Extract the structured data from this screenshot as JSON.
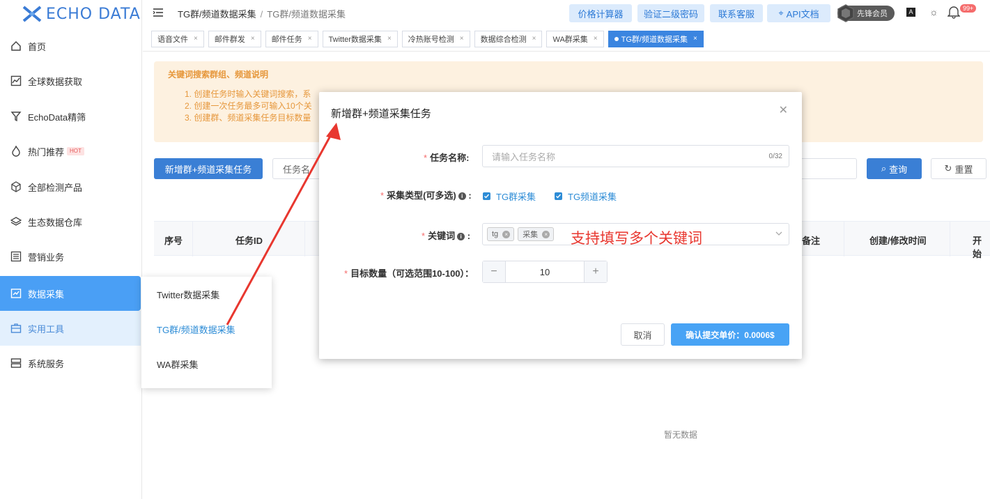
{
  "logo_text": "ECHO DATA",
  "sidebar": {
    "items": [
      {
        "label": "首页",
        "icon": "home-icon"
      },
      {
        "label": "全球数据获取",
        "icon": "chart-line-icon"
      },
      {
        "label": "EchoData精筛",
        "icon": "filter-icon"
      },
      {
        "label": "热门推荐",
        "icon": "fire-icon",
        "badge": "HOT"
      },
      {
        "label": "全部检测产品",
        "icon": "cube-icon"
      },
      {
        "label": "生态数据仓库",
        "icon": "layers-icon"
      },
      {
        "label": "营销业务",
        "icon": "list-icon"
      },
      {
        "label": "数据采集",
        "icon": "collect-icon"
      },
      {
        "label": "实用工具",
        "icon": "briefcase-icon"
      },
      {
        "label": "系统服务",
        "icon": "server-icon"
      }
    ],
    "flyout": [
      "Twitter数据采集",
      "TG群/频道数据采集",
      "WA群采集"
    ]
  },
  "header": {
    "breadcrumb": [
      "TG群/频道数据采集",
      "TG群/频道数据采集"
    ],
    "buttons": [
      "价格计算器",
      "验证二级密码",
      "联系客服",
      "API文档"
    ],
    "vip_label": "先锋会员",
    "notif_count": "99+"
  },
  "tabs": [
    "语音文件",
    "邮件群发",
    "邮件任务",
    "Twitter数据采集",
    "冷热账号检测",
    "数据综合检测",
    "WA群采集",
    "TG群/频道数据采集"
  ],
  "notice": {
    "title": "关键词搜索群组、频道说明",
    "lines": [
      "1. 创建任务时输入关键词搜索，系",
      "2. 创建一次任务最多可输入10个关",
      "3. 创建群、频道采集任务目标数量"
    ]
  },
  "toolbar": {
    "add_label": "新增群+频道采集任务",
    "filter_placeholder": "任务名",
    "query_label": "查询",
    "reset_label": "重置"
  },
  "table": {
    "headers": [
      "序号",
      "任务ID",
      "备注",
      "创建/修改时间",
      "开始"
    ],
    "empty_text": "暂无数据"
  },
  "modal": {
    "title": "新增群+频道采集任务",
    "task_name_label": "任务名称:",
    "task_name_placeholder": "请输入任务名称",
    "task_name_count": "0/32",
    "type_label": "采集类型(可多选)",
    "type_options": [
      "TG群采集",
      "TG频道采集"
    ],
    "keyword_label": "关键词",
    "keywords": [
      "tg",
      "采集"
    ],
    "keyword_note": "支持填写多个关键词",
    "target_label": "目标数量（可选范围10-100）：",
    "target_value": "10",
    "cancel_label": "取消",
    "submit_label": "确认提交单价：0.0006$"
  },
  "colors": {
    "accent": "#3a7fd5",
    "annotation": "#e8372f",
    "notice_bg": "#fdf1e0"
  }
}
